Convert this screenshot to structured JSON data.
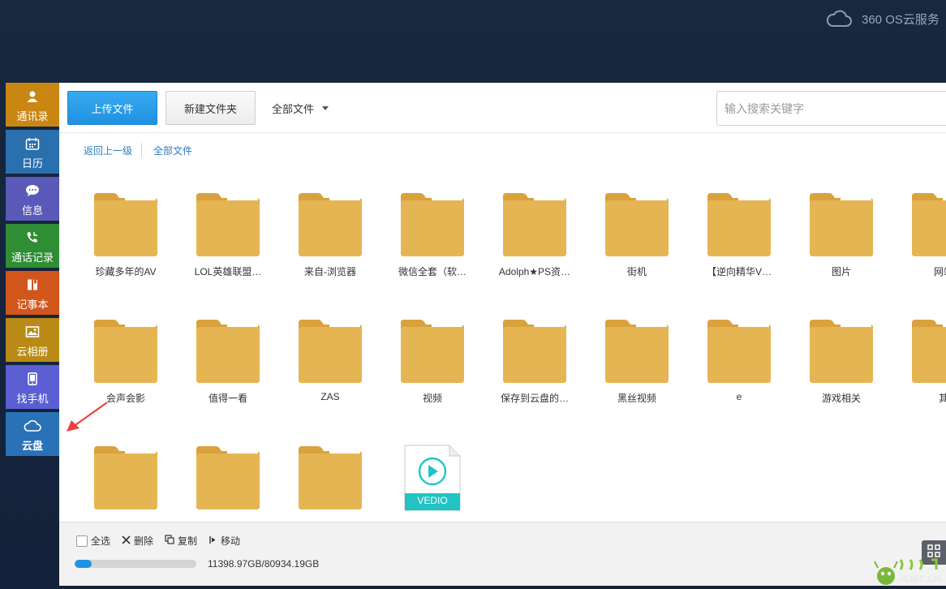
{
  "brand": {
    "text": "360 OS云服务",
    "icon": "cloud-icon"
  },
  "sidebar": {
    "items": [
      {
        "label": "通讯录",
        "icon": "contacts-icon",
        "color": "#c98612"
      },
      {
        "label": "日历",
        "icon": "calendar-icon",
        "color": "#2a6fae"
      },
      {
        "label": "信息",
        "icon": "message-icon",
        "color": "#5a58b8"
      },
      {
        "label": "通话记录",
        "icon": "phone-icon",
        "color": "#2f8d34"
      },
      {
        "label": "记事本",
        "icon": "notebook-icon",
        "color": "#d1561c"
      },
      {
        "label": "云相册",
        "icon": "photo-icon",
        "color": "#b98a16"
      },
      {
        "label": "找手机",
        "icon": "find-phone-icon",
        "color": "#5b5fd3"
      },
      {
        "label": "云盘",
        "icon": "cloud-disk-icon",
        "color": "#2a72b8",
        "active": true
      }
    ]
  },
  "toolbar": {
    "upload_label": "上传文件",
    "new_folder_label": "新建文件夹",
    "filter_label": "全部文件",
    "search_placeholder": "输入搜索关键字"
  },
  "breadcrumb": {
    "back_label": "返回上一级",
    "all_label": "全部文件"
  },
  "files": [
    {
      "name": "珍藏多年的AV",
      "type": "folder"
    },
    {
      "name": "LOL英雄联盟…",
      "type": "folder"
    },
    {
      "name": "来自-浏览器",
      "type": "folder"
    },
    {
      "name": "微信全套（软…",
      "type": "folder"
    },
    {
      "name": "Adolph★PS资…",
      "type": "folder"
    },
    {
      "name": "街机",
      "type": "folder"
    },
    {
      "name": "【逆向精华V…",
      "type": "folder"
    },
    {
      "name": "图片",
      "type": "folder"
    },
    {
      "name": "网站",
      "type": "folder"
    },
    {
      "name": "会声会影",
      "type": "folder"
    },
    {
      "name": "值得一看",
      "type": "folder"
    },
    {
      "name": "ZAS",
      "type": "folder"
    },
    {
      "name": "视频",
      "type": "folder"
    },
    {
      "name": "保存到云盘的…",
      "type": "folder"
    },
    {
      "name": "黑丝视频",
      "type": "folder"
    },
    {
      "name": "e",
      "type": "folder"
    },
    {
      "name": "游戏相关",
      "type": "folder"
    },
    {
      "name": "其",
      "type": "folder"
    },
    {
      "name": "",
      "type": "folder"
    },
    {
      "name": "",
      "type": "folder"
    },
    {
      "name": "",
      "type": "folder"
    },
    {
      "name": "",
      "type": "video",
      "badge": "VEDIO"
    }
  ],
  "bottom": {
    "select_all_label": "全选",
    "delete_label": "删除",
    "copy_label": "复制",
    "move_label": "移动",
    "storage_text": "11398.97GB/80934.19GB",
    "storage_fraction": 0.1408
  },
  "watermark": {
    "text": "JLWZ.CN"
  },
  "colors": {
    "accent": "#2a9ee8",
    "folder": "#e6b553",
    "video_badge": "#22c3c4",
    "arrow": "#e8453c"
  }
}
